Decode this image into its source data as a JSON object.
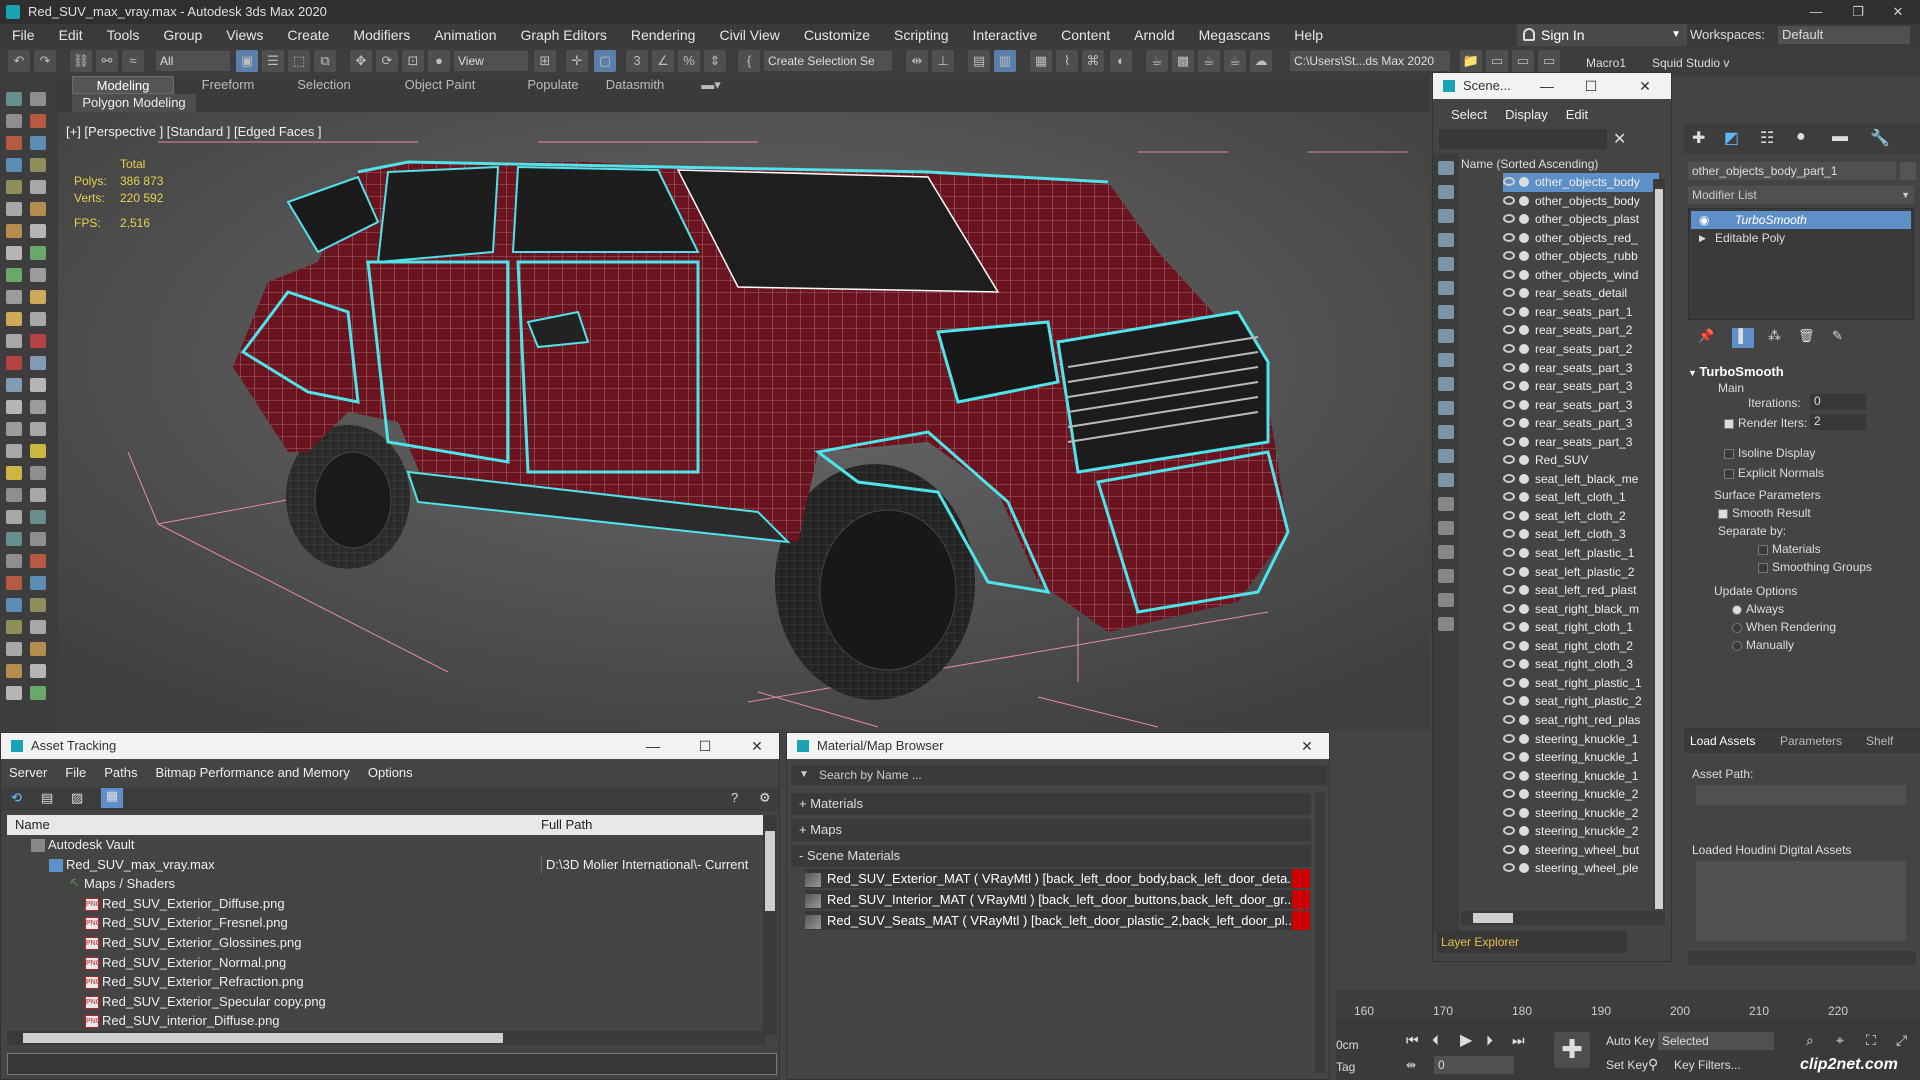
{
  "window": {
    "title": "Red_SUV_max_vray.max - Autodesk 3ds Max 2020"
  },
  "menu": [
    "File",
    "Edit",
    "Tools",
    "Group",
    "Views",
    "Create",
    "Modifiers",
    "Animation",
    "Graph Editors",
    "Rendering",
    "Civil View",
    "Customize",
    "Scripting",
    "Interactive",
    "Content",
    "Arnold",
    "Megascans",
    "Help"
  ],
  "signin": "Sign In",
  "workspaces": {
    "label": "Workspaces:",
    "value": "Default"
  },
  "toolbar": {
    "filter": "All",
    "refcoord": "View",
    "selset": "Create Selection Se",
    "path": "C:\\Users\\St...ds Max 2020",
    "macro": "Macro1",
    "squid": "Squid Studio v"
  },
  "ribbon": {
    "tabs": [
      "Modeling",
      "Freeform",
      "Selection",
      "Object Paint",
      "Populate",
      "Datasmith"
    ],
    "sub": "Polygon Modeling"
  },
  "viewport": {
    "label": "[+] [Perspective ] [Standard ] [Edged Faces ]",
    "total": "Total",
    "polys_label": "Polys:",
    "polys": "386 873",
    "verts_label": "Verts:",
    "verts": "220 592",
    "fps_label": "FPS:",
    "fps": "2,516"
  },
  "scene": {
    "title": "Scene...",
    "menu": [
      "Select",
      "Display",
      "Edit"
    ],
    "col": "Name (Sorted Ascending)",
    "footer": "Layer Explorer",
    "rows": [
      "other_objects_body",
      "other_objects_body",
      "other_objects_plast",
      "other_objects_red_",
      "other_objects_rubb",
      "other_objects_wind",
      "rear_seats_detail",
      "rear_seats_part_1",
      "rear_seats_part_2",
      "rear_seats_part_2",
      "rear_seats_part_3",
      "rear_seats_part_3",
      "rear_seats_part_3",
      "rear_seats_part_3",
      "rear_seats_part_3",
      "Red_SUV",
      "seat_left_black_me",
      "seat_left_cloth_1",
      "seat_left_cloth_2",
      "seat_left_cloth_3",
      "seat_left_plastic_1",
      "seat_left_plastic_2",
      "seat_left_red_plast",
      "seat_right_black_m",
      "seat_right_cloth_1",
      "seat_right_cloth_2",
      "seat_right_cloth_3",
      "seat_right_plastic_1",
      "seat_right_plastic_2",
      "seat_right_red_plas",
      "steering_knuckle_1",
      "steering_knuckle_1",
      "steering_knuckle_1",
      "steering_knuckle_2",
      "steering_knuckle_2",
      "steering_knuckle_2",
      "steering_wheel_but",
      "steering_wheel_ple"
    ]
  },
  "command": {
    "object": "other_objects_body_part_1",
    "modlist": "Modifier List",
    "stack": [
      "TurboSmooth",
      "Editable Poly"
    ],
    "ts_title": "TurboSmooth",
    "main": "Main",
    "iter_label": "Iterations:",
    "iter": "0",
    "render_label": "Render Iters:",
    "render": "2",
    "isoline": "Isoline Display",
    "explicit": "Explicit Normals",
    "surface": "Surface Parameters",
    "smooth": "Smooth Result",
    "sepby": "Separate by:",
    "materials": "Materials",
    "smgroups": "Smoothing Groups",
    "update": "Update Options",
    "always": "Always",
    "whenrender": "When Rendering",
    "manually": "Manually"
  },
  "houdini": {
    "tabs": [
      "Load Assets",
      "Parameters",
      "Shelf"
    ],
    "asset_path": "Asset Path:",
    "loaded": "Loaded Houdini Digital Assets"
  },
  "asset": {
    "title": "Asset Tracking",
    "menu": [
      "Server",
      "File",
      "Paths",
      "Bitmap Performance and Memory",
      "Options"
    ],
    "col_name": "Name",
    "col_path": "Full Path",
    "rows": [
      {
        "name": "Autodesk Vault",
        "path": "",
        "indent": 0,
        "type": "vault"
      },
      {
        "name": "Red_SUV_max_vray.max",
        "path": "D:\\3D Molier International\\- Current",
        "indent": 1,
        "type": "max"
      },
      {
        "name": "Maps / Shaders",
        "path": "",
        "indent": 2,
        "type": "maps"
      },
      {
        "name": "Red_SUV_Exterior_Diffuse.png",
        "path": "",
        "indent": 3,
        "type": "png"
      },
      {
        "name": "Red_SUV_Exterior_Fresnel.png",
        "path": "",
        "indent": 3,
        "type": "png"
      },
      {
        "name": "Red_SUV_Exterior_Glossines.png",
        "path": "",
        "indent": 3,
        "type": "png"
      },
      {
        "name": "Red_SUV_Exterior_Normal.png",
        "path": "",
        "indent": 3,
        "type": "png"
      },
      {
        "name": "Red_SUV_Exterior_Refraction.png",
        "path": "",
        "indent": 3,
        "type": "png"
      },
      {
        "name": "Red_SUV_Exterior_Specular copy.png",
        "path": "",
        "indent": 3,
        "type": "png"
      },
      {
        "name": "Red_SUV_interior_Diffuse.png",
        "path": "",
        "indent": 3,
        "type": "png"
      }
    ]
  },
  "matbrowser": {
    "title": "Material/Map Browser",
    "search": "Search by Name ...",
    "materials": "+ Materials",
    "maps": "+ Maps",
    "scene": "- Scene Materials",
    "rows": [
      "Red_SUV_Exterior_MAT ( VRayMtl ) [back_left_door_body,back_left_door_deta...",
      "Red_SUV_Interior_MAT ( VRayMtl ) [back_left_door_buttons,back_left_door_gr...",
      "Red_SUV_Seats_MAT ( VRayMtl ) [back_left_door_plastic_2,back_left_door_pl..."
    ]
  },
  "timeline": {
    "ticks": [
      "160",
      "170",
      "180",
      "190",
      "200",
      "210",
      "220"
    ],
    "autokey": "Auto Key",
    "setkey": "Set Key",
    "selected": "Selected",
    "keyfilters": "Key Filters...",
    "frame": "0",
    "cm": "0cm",
    "tag": "Tag",
    "watermark": "clip2net.com"
  }
}
